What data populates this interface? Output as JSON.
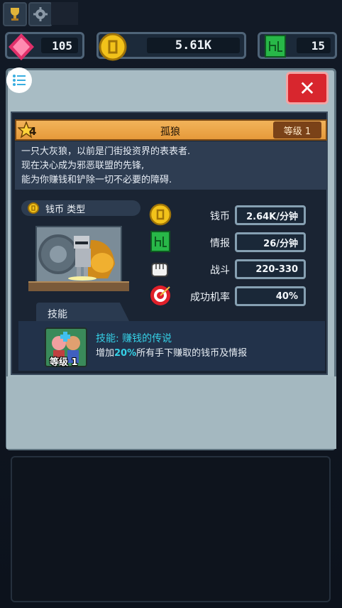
{
  "top_icons": [
    "trophy-icon",
    "gear-icon"
  ],
  "currency": {
    "gems": "105",
    "coins": "5.61K",
    "intel": "15"
  },
  "card": {
    "star_level": "4",
    "name": "孤狼",
    "level_label": "等级 1",
    "description": [
      "一只大灰狼，以前是门街投资界的表表者.",
      "现在决心成为邪恶联盟的先锋,",
      "能为你赚钱和铲除一切不必要的障碍."
    ],
    "type_label": "钱币 类型",
    "stats": [
      {
        "icon": "coin-icon",
        "label": "钱币",
        "value": "2.64K/分钟"
      },
      {
        "icon": "intel-icon",
        "label": "情报",
        "value": "26/分钟"
      },
      {
        "icon": "fist-icon",
        "label": "战斗",
        "value": "220-330"
      },
      {
        "icon": "target-icon",
        "label": "成功机率",
        "value": "40%"
      }
    ],
    "skill": {
      "tab_label": "技能",
      "level_label": "等级 1",
      "name": "技能: 赚钱的传说",
      "desc_prefix": "增加",
      "desc_highlight": "20%",
      "desc_suffix": "所有手下赚取的钱币及情报"
    }
  },
  "colors": {
    "accent_orange": "#e69a3a",
    "close_red": "#d8262e",
    "skill_cyan": "#35d0e6"
  }
}
